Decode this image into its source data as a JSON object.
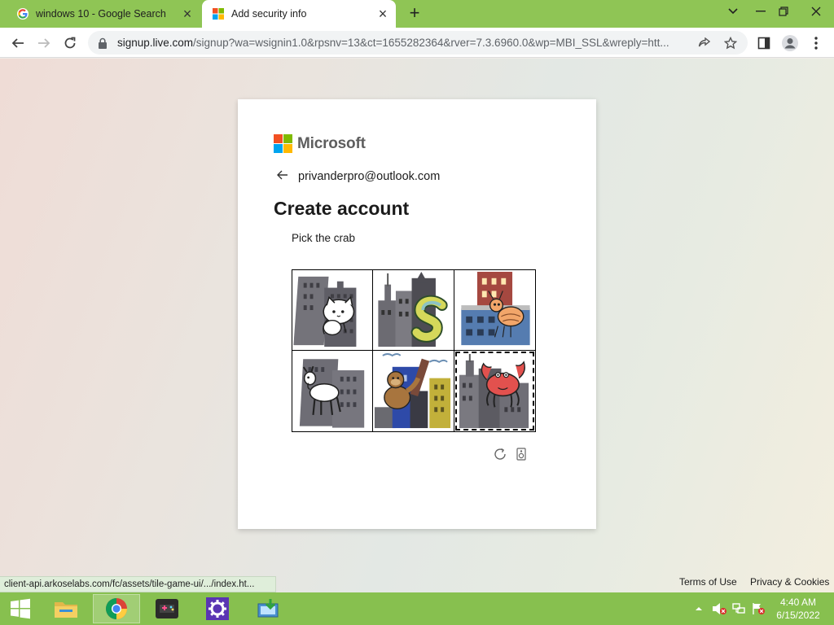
{
  "browser": {
    "tabs": [
      {
        "title": "windows 10 - Google Search",
        "icon": "google-icon"
      },
      {
        "title": "Add security info",
        "icon": "microsoft-icon",
        "active": true
      }
    ],
    "url_host": "signup.live.com",
    "url_rest": "/signup?wa=wsignin1.0&rpsnv=13&ct=1655282364&rver=7.3.6960.0&wp=MBI_SSL&wreply=htt..."
  },
  "signup": {
    "brand": "Microsoft",
    "account_email": "privanderpro@outlook.com",
    "heading": "Create account",
    "instruction": "Pick the crab",
    "tiles": [
      {
        "content": "cat-on-building"
      },
      {
        "content": "snake-on-building"
      },
      {
        "content": "shrimp-on-building"
      },
      {
        "content": "goat-on-building"
      },
      {
        "content": "monkey-on-building"
      },
      {
        "content": "crab-on-building",
        "selected": true
      }
    ]
  },
  "footer": {
    "terms": "Terms of Use",
    "privacy": "Privacy & Cookies"
  },
  "status_url": "client-api.arkoselabs.com/fc/assets/tile-game-ui/.../index.ht...",
  "taskbar": {
    "time": "4:40 AM",
    "date": "6/15/2022"
  },
  "colors": {
    "tabstrip": "#8fc555",
    "taskbar": "#87c04f",
    "ms_red": "#f25022",
    "ms_green": "#7fba00",
    "ms_blue": "#00a4ef",
    "ms_yellow": "#ffb900"
  }
}
